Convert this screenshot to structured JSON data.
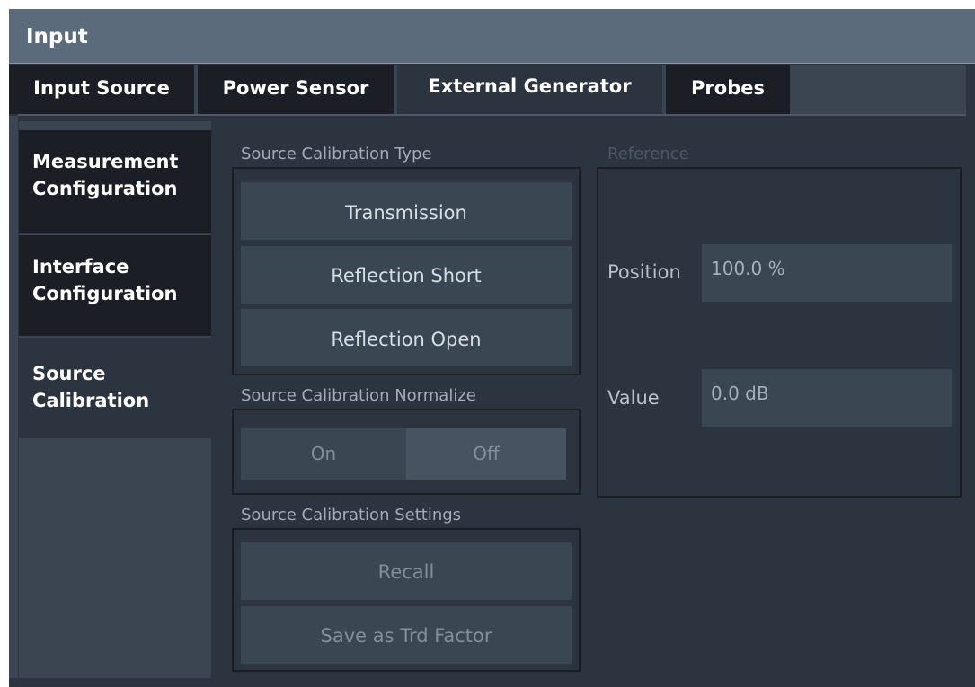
{
  "window": {
    "title": "Input"
  },
  "tabs": [
    {
      "label": "Input Source"
    },
    {
      "label": "Power Sensor"
    },
    {
      "label": "External Generator"
    },
    {
      "label": "Probes"
    }
  ],
  "sidenav": [
    {
      "line1": "Measurement",
      "line2": "Configuration"
    },
    {
      "line1": "Interface",
      "line2": "Configuration"
    },
    {
      "line1": "Source",
      "line2": "Calibration"
    }
  ],
  "calibration_type": {
    "label": "Source Calibration Type",
    "buttons": [
      "Transmission",
      "Reflection Short",
      "Reflection Open"
    ]
  },
  "normalize": {
    "label": "Source Calibration Normalize",
    "on_label": "On",
    "off_label": "Off",
    "selected": "Off"
  },
  "settings": {
    "label": "Source Calibration Settings",
    "recall_label": "Recall",
    "save_label": "Save as Trd Factor"
  },
  "reference": {
    "label": "Reference",
    "position_label": "Position",
    "position_value": "100.0 %",
    "value_label": "Value",
    "value_value": "0.0 dB"
  }
}
